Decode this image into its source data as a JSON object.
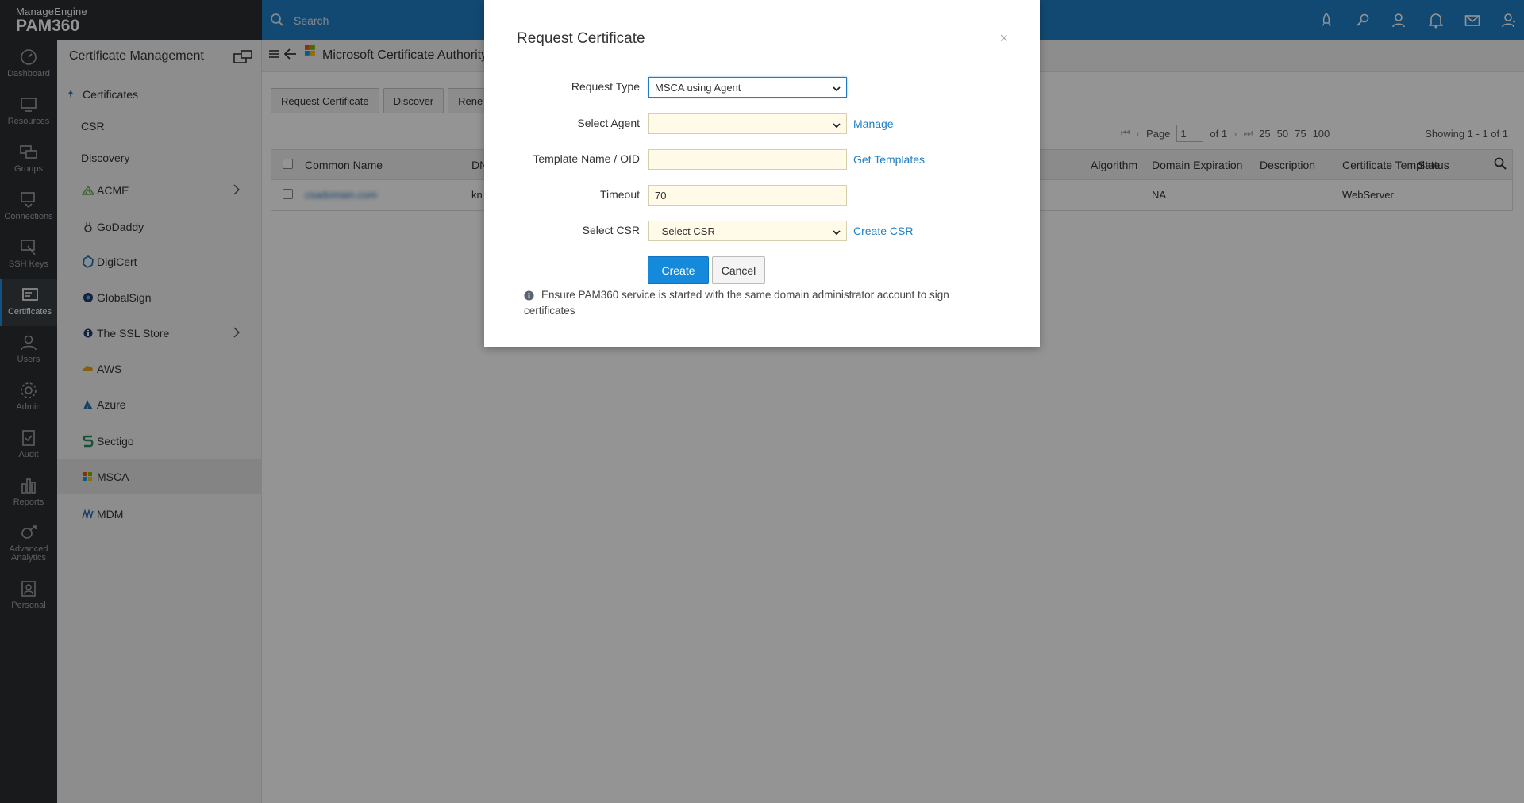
{
  "brand": {
    "line1": "ManageEngine",
    "line2": "PAM360"
  },
  "search": {
    "placeholder": "Search"
  },
  "rail": [
    {
      "label": "Dashboard",
      "icon": "dashboard-icon"
    },
    {
      "label": "Resources",
      "icon": "resources-icon"
    },
    {
      "label": "Groups",
      "icon": "groups-icon"
    },
    {
      "label": "Connections",
      "icon": "connections-icon"
    },
    {
      "label": "SSH Keys",
      "icon": "ssh-keys-icon"
    },
    {
      "label": "Certificates",
      "icon": "certificates-icon"
    },
    {
      "label": "Users",
      "icon": "users-icon"
    },
    {
      "label": "Admin",
      "icon": "admin-icon"
    },
    {
      "label": "Audit",
      "icon": "audit-icon"
    },
    {
      "label": "Reports",
      "icon": "reports-icon"
    },
    {
      "label": "Advanced",
      "label2": "Analytics",
      "icon": "analytics-icon"
    },
    {
      "label": "Personal",
      "icon": "personal-icon"
    }
  ],
  "sidebar": {
    "title": "Certificate Management",
    "items": [
      {
        "label": "Certificates"
      },
      {
        "label": "CSR"
      },
      {
        "label": "Discovery"
      },
      {
        "label": "ACME"
      },
      {
        "label": "GoDaddy"
      },
      {
        "label": "DigiCert"
      },
      {
        "label": "GlobalSign"
      },
      {
        "label": "The SSL Store"
      },
      {
        "label": "AWS"
      },
      {
        "label": "Azure"
      },
      {
        "label": "Sectigo"
      },
      {
        "label": "MSCA"
      },
      {
        "label": "MDM"
      }
    ]
  },
  "main": {
    "title": "Microsoft Certificate Authority",
    "toolbar": {
      "request": "Request Certificate",
      "discover": "Discover",
      "renew": "Rene"
    },
    "pager": {
      "page_label": "Page",
      "page_value": "1",
      "of": "of 1",
      "sizes": [
        "25",
        "50",
        "75",
        "100"
      ]
    },
    "showing": "Showing 1 - 1 of 1",
    "columns": {
      "common_name": "Common Name",
      "dn": "DN",
      "algorithm": "Algorithm",
      "domain_expiration": "Domain Expiration",
      "description": "Description",
      "certificate_template": "Certificate Template",
      "status": "Status"
    },
    "row": {
      "common_name": "csadomain.com",
      "dn": "kn",
      "domain_expiration": "NA",
      "certificate_template": "WebServer"
    }
  },
  "modal": {
    "title": "Request Certificate",
    "close": "×",
    "request_type": {
      "label": "Request Type",
      "value": "MSCA using Agent"
    },
    "select_agent": {
      "label": "Select Agent",
      "value": "",
      "link": "Manage"
    },
    "template": {
      "label": "Template Name / OID",
      "value": "",
      "link": "Get Templates"
    },
    "timeout": {
      "label": "Timeout",
      "value": "70"
    },
    "select_csr": {
      "label": "Select CSR",
      "value": "--Select CSR--",
      "link": "Create CSR"
    },
    "create": "Create",
    "cancel": "Cancel",
    "note": "Ensure PAM360 service is started with the same domain administrator account to sign certificates"
  },
  "colors": {
    "topbar": "#1f7ec4",
    "rail": "#2a2d31",
    "primary_button": "#1589dc",
    "link": "#1f7ec4"
  }
}
